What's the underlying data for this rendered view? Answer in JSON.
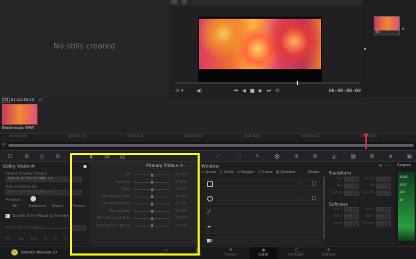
{
  "gallery": {
    "empty_text": "No stills created"
  },
  "viewer": {
    "timecode": "00:00:08:09"
  },
  "nodes": {
    "node_label": "01"
  },
  "clip": {
    "number": "01",
    "timecode": "01:22:30:13",
    "track": "V1",
    "name": "Blackmagic RAW"
  },
  "ruler": {
    "ticks": [
      "00:00:00:00",
      "00:00:01:08",
      "00:00:02:16",
      "00:00:04:00",
      "00:00:05:08",
      "00:00:06:16",
      "00:00:08:00"
    ]
  },
  "dolby": {
    "title": "Dolby Vision®",
    "target_label": "Target Display Output",
    "target_value": "100-nit, BT.709, BT.1886, Full",
    "time_controls_label": "Trim Controls for",
    "time_controls_value": "100-nit, BT.709, BT.1886, Full",
    "analyze_label": "Analyze",
    "buttons": [
      "All",
      "Selected",
      "Blend",
      "Frame"
    ],
    "checkbox_label": "Enable Tone Mapping Preview",
    "mid_contrast_label": "Mid Contrast Offset",
    "bottom_labels": [
      "Min",
      "Avg",
      "Max",
      "Pl",
      "Fe",
      "Rt"
    ]
  },
  "trims": {
    "dropdown": "Primary Trims",
    "rows": [
      {
        "label": "Lift",
        "value": "0.000"
      },
      {
        "label": "Gamma",
        "value": "0.000"
      },
      {
        "label": "Gain",
        "value": "0.000"
      },
      {
        "label": "Saturation Gain",
        "value": "0.000"
      },
      {
        "label": "Chroma Weight",
        "value": "0.000"
      },
      {
        "label": "Tone Detail",
        "value": "0.000"
      },
      {
        "label": "Mid Contrast Bias",
        "value": "0.000"
      },
      {
        "label": "Highlight Clipping",
        "value": "0.000"
      }
    ]
  },
  "window": {
    "title": "Window",
    "tools": [
      "Linear",
      "Circle",
      "Polygon",
      "Curve",
      "Gradient"
    ],
    "delete": "Delete",
    "shapes": [
      "square-icon",
      "circle-icon",
      "line-icon",
      "pen-icon",
      "gradient-icon"
    ]
  },
  "transform": {
    "title": "Transform",
    "fields": [
      {
        "label": "Size",
        "value": "50.00"
      },
      {
        "label": "Aspect",
        "value": "50.00"
      },
      {
        "label": "Pan",
        "value": "50.00"
      },
      {
        "label": "Tilt",
        "value": "50.00"
      },
      {
        "label": "Rotate",
        "value": "0.00"
      },
      {
        "label": "Opacity",
        "value": "100.00"
      }
    ],
    "softness_title": "Softness",
    "softness": [
      {
        "label": "Soft 1",
        "value": "1.00"
      },
      {
        "label": "Soft 3",
        "value": "0.00"
      },
      {
        "label": "Soft 2",
        "value": "0.00"
      },
      {
        "label": "Soft 4",
        "value": "0.00"
      },
      {
        "label": "Inside",
        "value": "0.00"
      },
      {
        "label": "Outside",
        "value": "0.00"
      }
    ]
  },
  "scopes": {
    "title": "Scopes",
    "levels": [
      "10000",
      "1000",
      "100",
      "10"
    ]
  },
  "app": {
    "name": "DaVinci Resolve 17"
  },
  "nav": [
    {
      "label": "Media",
      "icon": "media-icon"
    },
    {
      "label": "Edit",
      "icon": "edit-icon"
    },
    {
      "label": "Fusion",
      "icon": "fusion-icon"
    },
    {
      "label": "Color",
      "icon": "color-icon",
      "active": true
    },
    {
      "label": "Fairlight",
      "icon": "fairlight-icon"
    },
    {
      "label": "Deliver",
      "icon": "deliver-icon"
    }
  ],
  "colors": {
    "accent_highlight": "#ffff00",
    "playhead": "#ee3333"
  }
}
